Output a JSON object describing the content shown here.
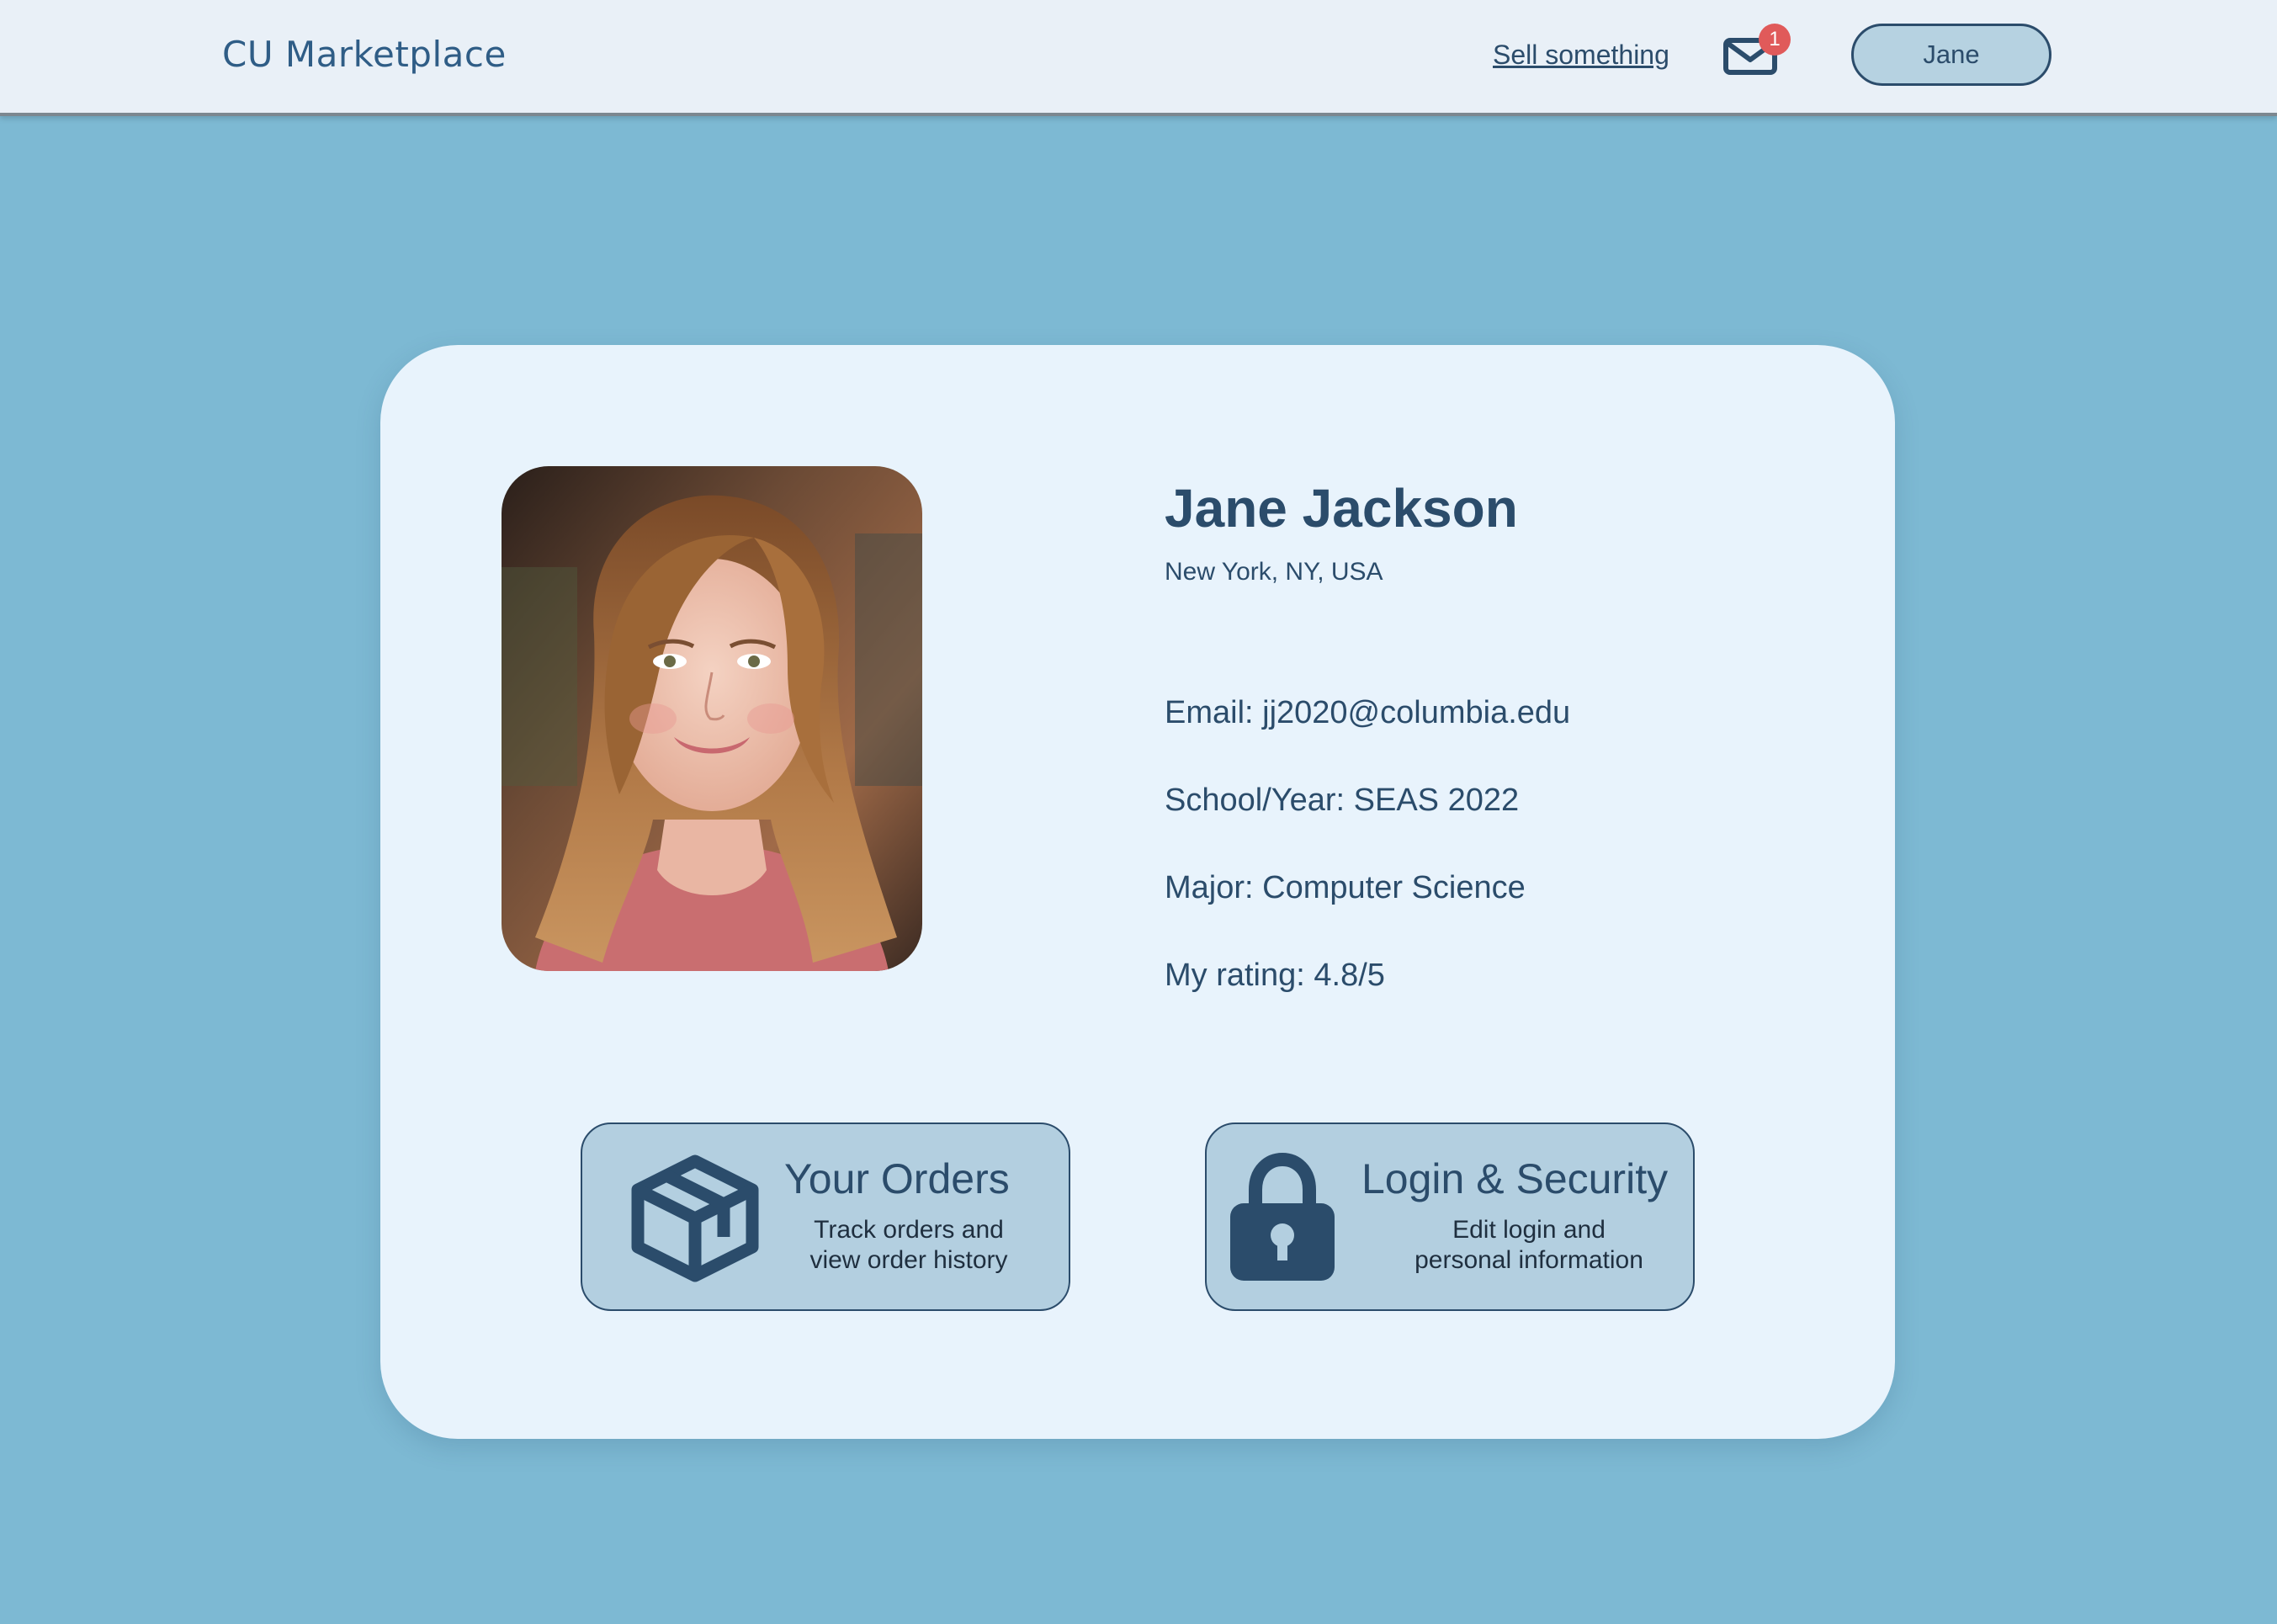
{
  "navbar": {
    "brand": "CU Marketplace",
    "sell_link": "Sell something",
    "mail_badge_count": "1",
    "mail_icon": "envelope-icon",
    "user_button": "Jane"
  },
  "profile": {
    "name": "Jane Jackson",
    "location": "New York, NY, USA",
    "email": "Email: jj2020@columbia.edu",
    "school_year": "School/Year: SEAS 2022",
    "major": "Major: Computer Science",
    "rating": "My rating: 4.8/5",
    "photo": "profile-photo"
  },
  "actions": {
    "orders": {
      "icon": "package-icon",
      "title": "Your Orders",
      "subtitle": "Track orders and\nview order history"
    },
    "security": {
      "icon": "lock-icon",
      "title": "Login & Security",
      "subtitle": "Edit login and\npersonal information"
    }
  },
  "colors": {
    "page_background": "#7db9d3",
    "navbar_background": "#e9f0f7",
    "card_background": "#e8f3fc",
    "accent_dark": "#2b4c6b",
    "action_card_background": "#b3cfe0",
    "badge_red": "#e05a5a"
  }
}
